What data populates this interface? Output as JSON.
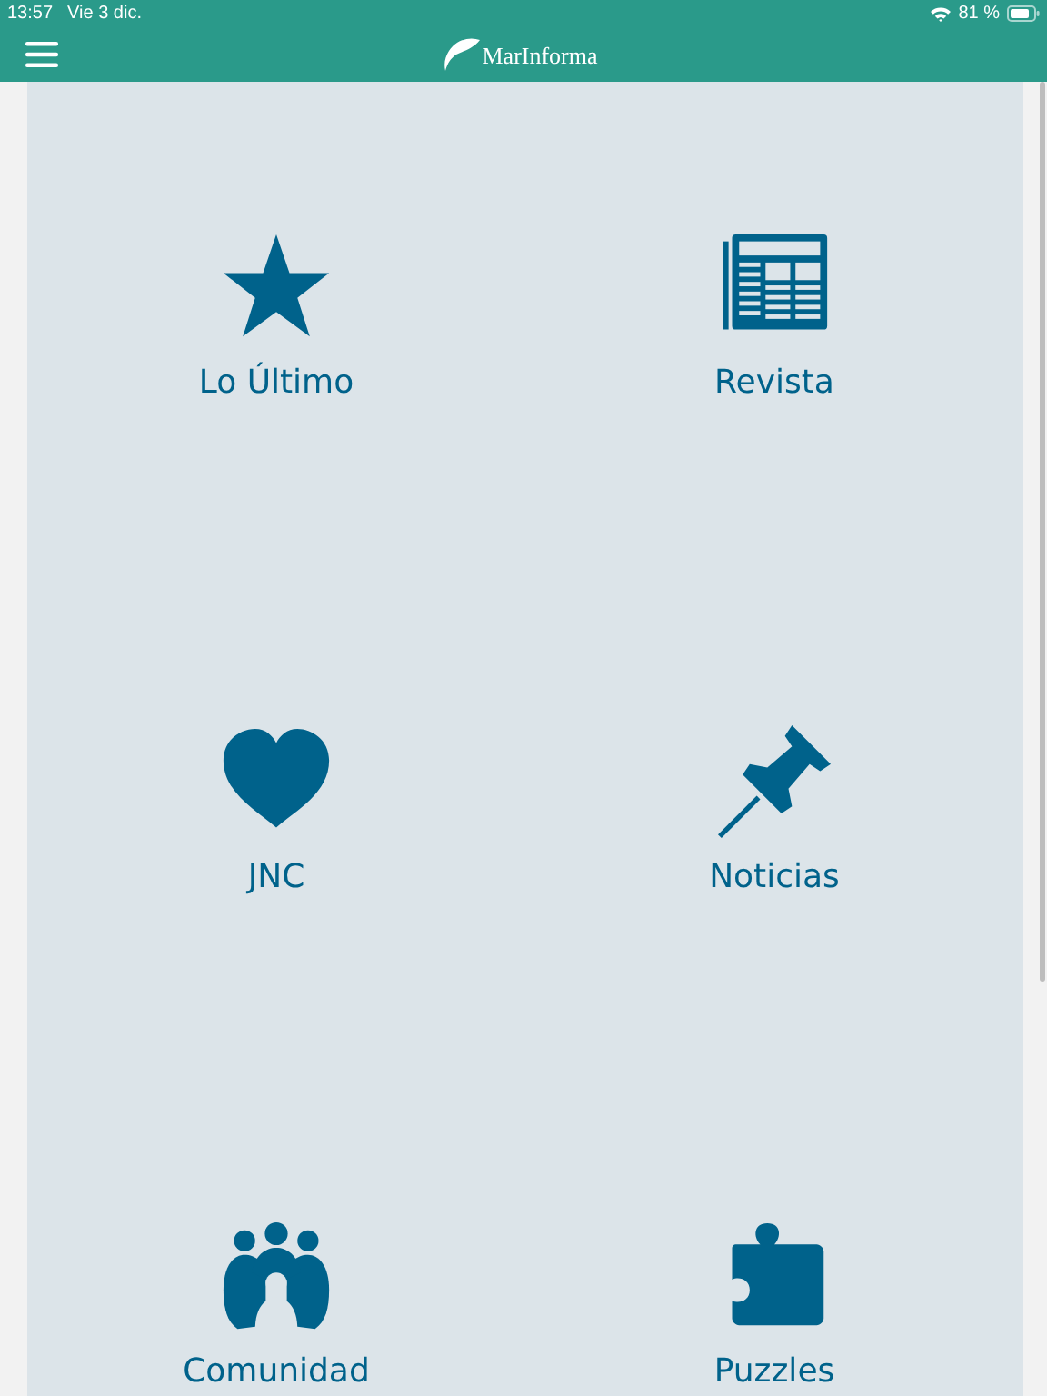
{
  "status_bar": {
    "time": "13:57",
    "date": "Vie 3 dic.",
    "battery": "81 %"
  },
  "app_bar": {
    "title": "MarInforma"
  },
  "tiles": [
    {
      "label": "Lo Último"
    },
    {
      "label": "Revista"
    },
    {
      "label": "JNC"
    },
    {
      "label": "Noticias"
    },
    {
      "label": "Comunidad"
    },
    {
      "label": "Puzzles"
    }
  ]
}
